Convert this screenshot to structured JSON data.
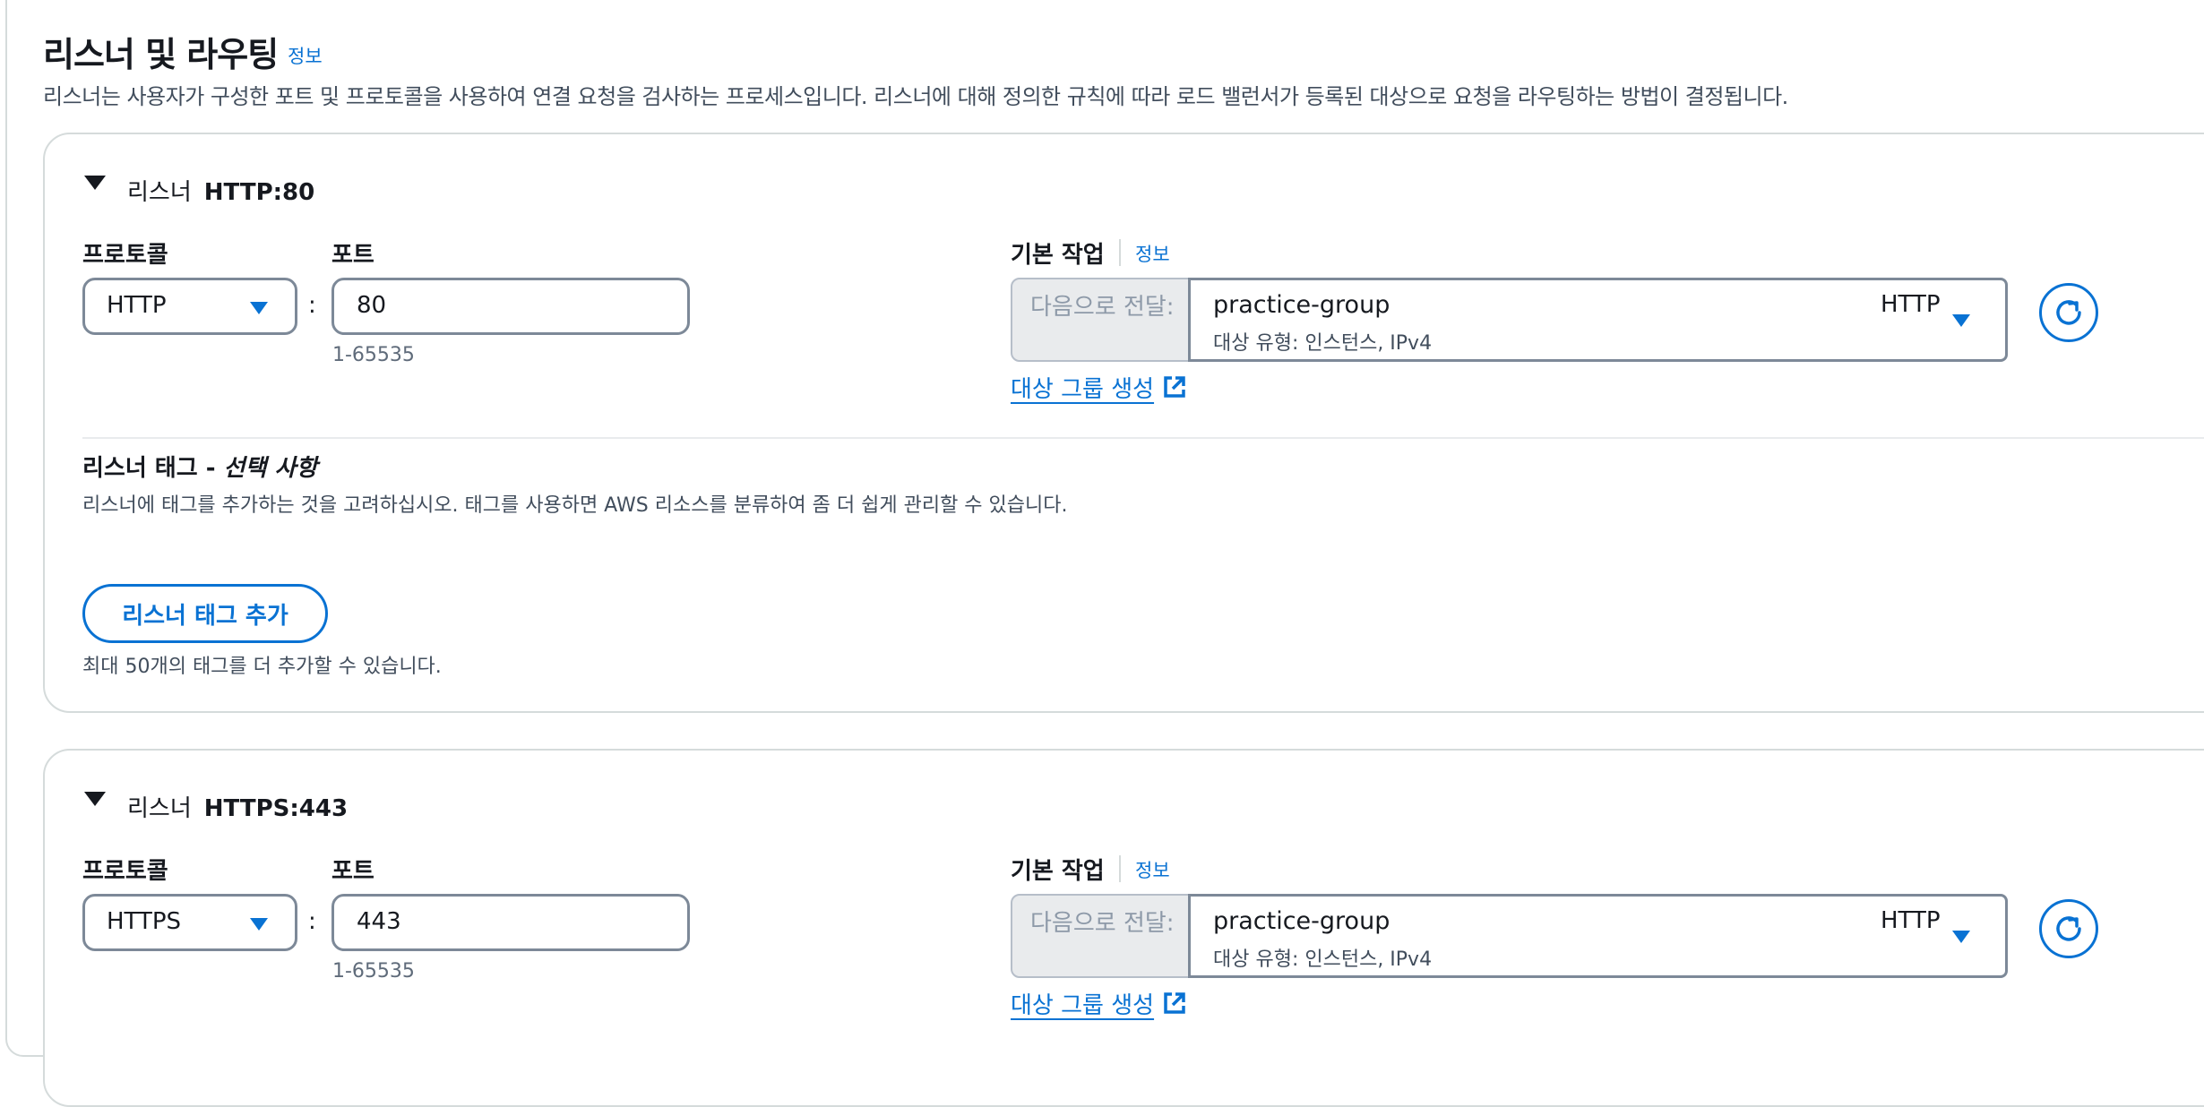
{
  "section": {
    "title": "리스너 및 라우팅",
    "info": "정보",
    "description": "리스너는 사용자가 구성한 포트 및 프로토콜을 사용하여 연결 요청을 검사하는 프로세스입니다. 리스너에 대해 정의한 규칙에 따라 로드 밸런서가 등록된 대상으로 요청을 라우팅하는 방법이 결정됩니다."
  },
  "listeners": [
    {
      "header_prefix": "리스너",
      "header_name": "HTTP:80",
      "protocol_label": "프로토콜",
      "protocol_value": "HTTP",
      "port_label": "포트",
      "port_value": "80",
      "port_hint": "1-65535",
      "action_label": "기본 작업",
      "action_info": "정보",
      "forward_prefix": "다음으로 전달:",
      "target_name": "practice-group",
      "target_protocol": "HTTP",
      "target_sub": "대상 유형: 인스턴스, IPv4",
      "create_target_group": "대상 그룹 생성",
      "tags": {
        "title": "리스너 태그 - ",
        "title_optional": "선택 사항",
        "description": "리스너에 태그를 추가하는 것을 고려하십시오. 태그를 사용하면 AWS 리소스를 분류하여 좀 더 쉽게 관리할 수 있습니다.",
        "add_button": "리스너 태그 추가",
        "limit_text": "최대 50개의 태그를 더 추가할 수 있습니다."
      }
    },
    {
      "header_prefix": "리스너",
      "header_name": "HTTPS:443",
      "protocol_label": "프로토콜",
      "protocol_value": "HTTPS",
      "port_label": "포트",
      "port_value": "443",
      "port_hint": "1-65535",
      "action_label": "기본 작업",
      "action_info": "정보",
      "forward_prefix": "다음으로 전달:",
      "target_name": "practice-group",
      "target_protocol": "HTTP",
      "target_sub": "대상 유형: 인스턴스, IPv4",
      "create_target_group": "대상 그룹 생성"
    }
  ],
  "icons": {
    "expand": "caret-down-icon",
    "select": "caret-down-icon",
    "refresh": "refresh-icon",
    "external": "external-link-icon"
  },
  "colors": {
    "link": "#0972d3",
    "border": "#7d8998",
    "text": "#16191f"
  }
}
